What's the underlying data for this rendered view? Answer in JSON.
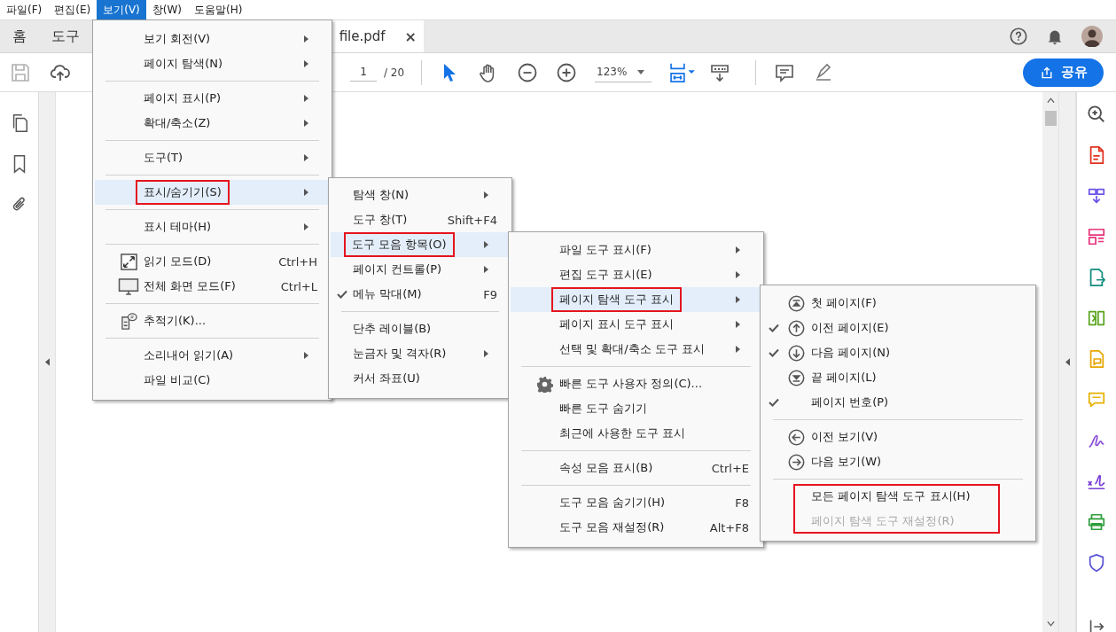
{
  "menubar": [
    {
      "label": "파일(F)",
      "selected": false
    },
    {
      "label": "편집(E)",
      "selected": false
    },
    {
      "label": "보기(V)",
      "selected": true
    },
    {
      "label": "창(W)",
      "selected": false
    },
    {
      "label": "도움말(H)",
      "selected": false
    }
  ],
  "tabs": [
    {
      "label": "홈",
      "selected": false
    },
    {
      "label": "도구",
      "selected": false
    },
    {
      "label": "file.pdf",
      "selected": true,
      "close": "×"
    }
  ],
  "toolbar": {
    "page": "1",
    "page_total": "/ 20",
    "zoom": "123%",
    "share": "공유"
  },
  "menus": [
    {
      "items": [
        {
          "kind": "item",
          "label": "보기 회전(V)",
          "submenu": true,
          "selected": false,
          "marked": false
        },
        {
          "kind": "item",
          "label": "페이지 탐색(N)",
          "submenu": true,
          "selected": false,
          "marked": false
        },
        {
          "kind": "separator"
        },
        {
          "kind": "item",
          "label": "페이지 표시(P)",
          "submenu": true,
          "selected": false,
          "marked": false
        },
        {
          "kind": "item",
          "label": "확대/축소(Z)",
          "submenu": true,
          "selected": false,
          "marked": false
        },
        {
          "kind": "separator"
        },
        {
          "kind": "item",
          "label": "도구(T)",
          "submenu": true,
          "selected": false,
          "marked": false
        },
        {
          "kind": "separator"
        },
        {
          "kind": "item",
          "label": "표시/숨기기(S)",
          "submenu": true,
          "selected": true,
          "marked": true
        },
        {
          "kind": "separator"
        },
        {
          "kind": "item",
          "label": "표시 테마(H)",
          "submenu": true,
          "selected": false,
          "marked": false
        },
        {
          "kind": "separator"
        },
        {
          "kind": "item",
          "label": "읽기 모드(D)",
          "shortcut": "Ctrl+H",
          "selected": false,
          "marked": false
        },
        {
          "kind": "item",
          "label": "전체 화면 모드(F)",
          "shortcut": "Ctrl+L",
          "selected": false,
          "marked": false
        },
        {
          "kind": "separator"
        },
        {
          "kind": "item",
          "label": "추적기(K)...",
          "selected": false,
          "marked": false
        },
        {
          "kind": "separator"
        },
        {
          "kind": "item",
          "label": "소리내어 읽기(A)",
          "submenu": true,
          "selected": false,
          "marked": false
        },
        {
          "kind": "item",
          "label": "파일 비교(C)",
          "selected": false,
          "marked": false
        }
      ]
    },
    {
      "items": [
        {
          "kind": "item",
          "label": "탐색 창(N)",
          "submenu": true,
          "checked": false,
          "selected": false,
          "marked": false
        },
        {
          "kind": "item",
          "label": "도구 창(T)",
          "shortcut": "Shift+F4",
          "checked": false,
          "selected": false,
          "marked": false
        },
        {
          "kind": "item",
          "label": "도구 모음 항목(O)",
          "submenu": true,
          "checked": false,
          "selected": true,
          "marked": true
        },
        {
          "kind": "item",
          "label": "페이지 컨트롤(P)",
          "submenu": true,
          "checked": false,
          "selected": false,
          "marked": false
        },
        {
          "kind": "item",
          "label": "메뉴 막대(M)",
          "shortcut": "F9",
          "checked": true,
          "selected": false,
          "marked": false
        },
        {
          "kind": "separator"
        },
        {
          "kind": "item",
          "label": "단추 레이블(B)",
          "checked": false,
          "selected": false,
          "marked": false
        },
        {
          "kind": "item",
          "label": "눈금자 및 격자(R)",
          "submenu": true,
          "checked": false,
          "selected": false,
          "marked": false
        },
        {
          "kind": "item",
          "label": "커서 좌표(U)",
          "checked": false,
          "selected": false,
          "marked": false
        }
      ]
    },
    {
      "items": [
        {
          "kind": "item",
          "label": "파일 도구 표시(F)",
          "submenu": true,
          "selected": false,
          "marked": false
        },
        {
          "kind": "item",
          "label": "편집 도구 표시(E)",
          "submenu": true,
          "selected": false,
          "marked": false
        },
        {
          "kind": "item",
          "label": "페이지 탐색 도구 표시",
          "submenu": true,
          "selected": true,
          "marked": true
        },
        {
          "kind": "item",
          "label": "페이지 표시 도구 표시",
          "submenu": true,
          "selected": false,
          "marked": false
        },
        {
          "kind": "item",
          "label": "선택 및 확대/축소 도구 표시",
          "submenu": true,
          "selected": false,
          "marked": false
        },
        {
          "kind": "separator"
        },
        {
          "kind": "item",
          "label": "빠른 도구 사용자 정의(C)...",
          "selected": false,
          "marked": false
        },
        {
          "kind": "item",
          "label": "빠른 도구 숨기기",
          "selected": false,
          "marked": false
        },
        {
          "kind": "item",
          "label": "최근에 사용한 도구 표시",
          "selected": false,
          "marked": false
        },
        {
          "kind": "separator"
        },
        {
          "kind": "item",
          "label": "속성 모음 표시(B)",
          "shortcut": "Ctrl+E",
          "selected": false,
          "marked": false
        },
        {
          "kind": "separator"
        },
        {
          "kind": "item",
          "label": "도구 모음 숨기기(H)",
          "shortcut": "F8",
          "selected": false,
          "marked": false
        },
        {
          "kind": "item",
          "label": "도구 모음 재설정(R)",
          "shortcut": "Alt+F8",
          "selected": false,
          "marked": false
        }
      ]
    },
    {
      "items": [
        {
          "kind": "item",
          "label": "첫 페이지(F)",
          "checked": false,
          "disabled": false,
          "marked": false
        },
        {
          "kind": "item",
          "label": "이전 페이지(E)",
          "checked": true,
          "disabled": false,
          "marked": false
        },
        {
          "kind": "item",
          "label": "다음 페이지(N)",
          "checked": true,
          "disabled": false,
          "marked": false
        },
        {
          "kind": "item",
          "label": "끝 페이지(L)",
          "checked": false,
          "disabled": false,
          "marked": false
        },
        {
          "kind": "item",
          "label": "페이지 번호(P)",
          "checked": true,
          "disabled": false,
          "marked": false
        },
        {
          "kind": "separator"
        },
        {
          "kind": "item",
          "label": "이전 보기(V)",
          "checked": false,
          "disabled": false,
          "marked": false
        },
        {
          "kind": "item",
          "label": "다음 보기(W)",
          "checked": false,
          "disabled": false,
          "marked": false
        },
        {
          "kind": "separator"
        },
        {
          "kind": "item",
          "label": "모든 페이지 탐색 도구 표시(H)",
          "checked": false,
          "disabled": false,
          "marked": true
        },
        {
          "kind": "item",
          "label": "페이지 탐색 도구 재설정(R)",
          "checked": false,
          "disabled": true,
          "marked": true
        }
      ]
    }
  ]
}
